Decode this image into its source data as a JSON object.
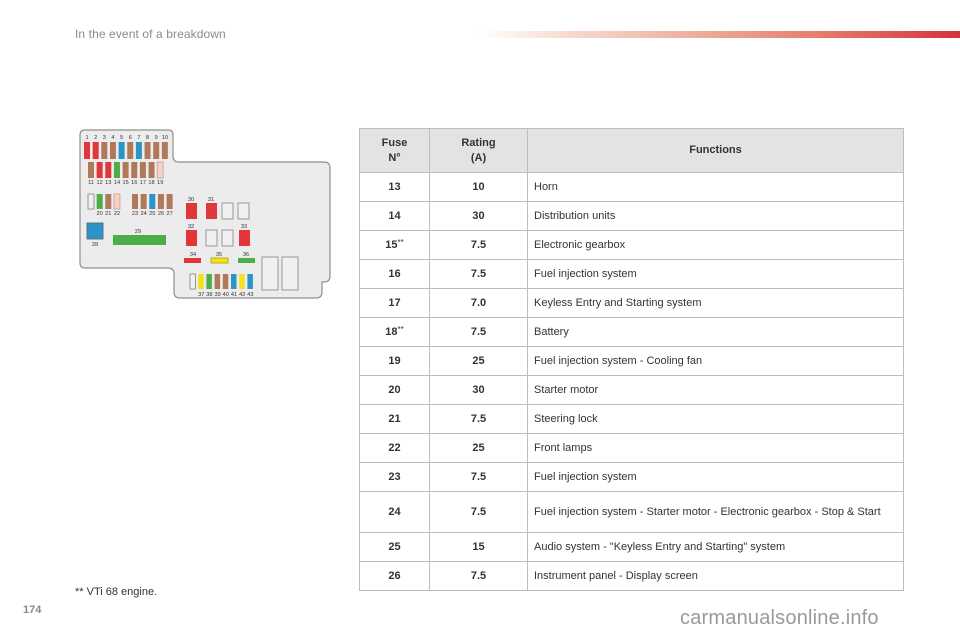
{
  "header": {
    "title": "In the event of a breakdown",
    "accent_color": "#d6323c"
  },
  "diagram": {
    "colors": {
      "red": "#e0363c",
      "brown": "#b07a5a",
      "blue": "#2b95c8",
      "green": "#4cae47",
      "pink": "#f8d0c4",
      "yellow": "#f3e21b",
      "empty": "#f0f0f0"
    },
    "labels": {
      "f1": "1",
      "f2": "2",
      "f3": "3",
      "f4": "4",
      "f5": "5",
      "f6": "6",
      "f7": "7",
      "f8": "8",
      "f9": "9",
      "f10": "10",
      "f11": "11",
      "f12": "12",
      "f13": "13",
      "f14": "14",
      "f15": "15",
      "f16": "16",
      "f17": "17",
      "f18": "18",
      "f19": "19",
      "f20": "20",
      "f21": "21",
      "f22": "22",
      "f23": "23",
      "f24": "24",
      "f25": "25",
      "f26": "26",
      "f27": "27",
      "f28": "28",
      "f29": "29",
      "f30": "30",
      "f31": "31",
      "f32": "32",
      "f33": "33",
      "f34": "34",
      "f35": "35",
      "f36": "36",
      "f37": "37",
      "f38": "38",
      "f39": "39",
      "f40": "40",
      "f41": "41",
      "f42": "42",
      "f43": "43"
    },
    "row1_colors": [
      "red",
      "red",
      "brown",
      "brown",
      "blue",
      "brown",
      "blue",
      "brown",
      "brown",
      "brown"
    ],
    "row2_colors": [
      "brown",
      "red",
      "red",
      "green",
      "brown",
      "brown",
      "brown",
      "brown",
      "pink"
    ],
    "row3_left_colors": [
      "empty",
      "green",
      "brown",
      "pink"
    ],
    "row3_right_colors": [
      "brown",
      "brown",
      "blue",
      "brown",
      "brown"
    ],
    "row_bottom_colors": [
      "empty",
      "yellow",
      "green",
      "brown",
      "brown",
      "blue",
      "yellow",
      "blue"
    ]
  },
  "table": {
    "headers": {
      "fuse": "Fuse",
      "fuse_sub": "N°",
      "rating": "Rating",
      "rating_sub": "(A)",
      "functions": "Functions"
    },
    "rows": [
      {
        "fuse": "13",
        "mark": "",
        "rating": "10",
        "function": "Horn"
      },
      {
        "fuse": "14",
        "mark": "",
        "rating": "30",
        "function": "Distribution units"
      },
      {
        "fuse": "15",
        "mark": "**",
        "rating": "7.5",
        "function": "Electronic gearbox"
      },
      {
        "fuse": "16",
        "mark": "",
        "rating": "7.5",
        "function": "Fuel injection system"
      },
      {
        "fuse": "17",
        "mark": "",
        "rating": "7.0",
        "function": "Keyless Entry and Starting system"
      },
      {
        "fuse": "18",
        "mark": "**",
        "rating": "7.5",
        "function": "Battery"
      },
      {
        "fuse": "19",
        "mark": "",
        "rating": "25",
        "function": "Fuel injection system - Cooling fan"
      },
      {
        "fuse": "20",
        "mark": "",
        "rating": "30",
        "function": "Starter motor"
      },
      {
        "fuse": "21",
        "mark": "",
        "rating": "7.5",
        "function": "Steering lock"
      },
      {
        "fuse": "22",
        "mark": "",
        "rating": "25",
        "function": "Front lamps"
      },
      {
        "fuse": "23",
        "mark": "",
        "rating": "7.5",
        "function": "Fuel injection system"
      },
      {
        "fuse": "24",
        "mark": "",
        "rating": "7.5",
        "function": "Fuel injection system - Starter motor - Electronic gearbox - Stop & Start"
      },
      {
        "fuse": "25",
        "mark": "",
        "rating": "15",
        "function": "Audio system - \"Keyless Entry and Starting\" system"
      },
      {
        "fuse": "26",
        "mark": "",
        "rating": "7.5",
        "function": "Instrument panel - Display screen"
      }
    ]
  },
  "footnote": "** VTi 68 engine.",
  "page_number": "174",
  "watermark": "carmanualsonline.info"
}
